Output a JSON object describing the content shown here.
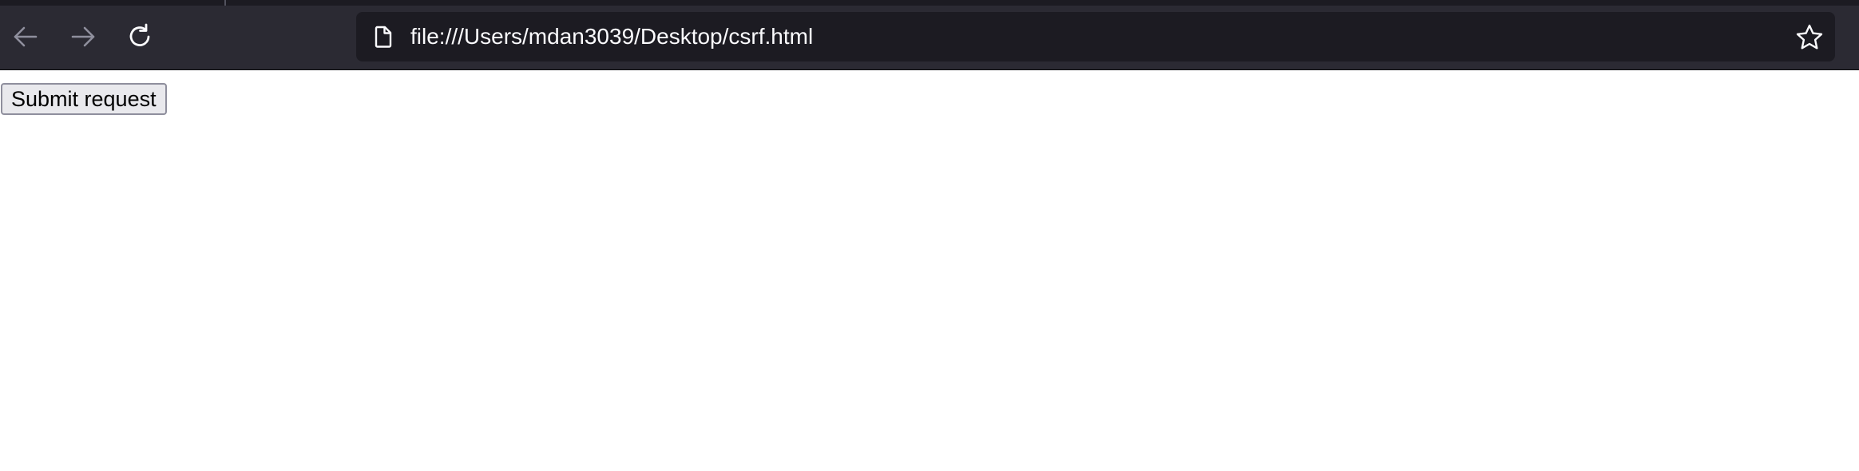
{
  "browser": {
    "url": "file:///Users/mdan3039/Desktop/csrf.html",
    "icons": {
      "back": "arrow-left-icon",
      "forward": "arrow-right-icon",
      "reload": "reload-icon",
      "page": "page-icon",
      "bookmark": "star-icon"
    },
    "colors": {
      "toolbar": "#2b2a33",
      "urlbar": "#1c1b22",
      "url_text": "#fbfbfe",
      "disabled_icon": "#8f8f9d"
    }
  },
  "page": {
    "submit_button_label": "Submit request",
    "button_background": "#e9e9ed"
  }
}
